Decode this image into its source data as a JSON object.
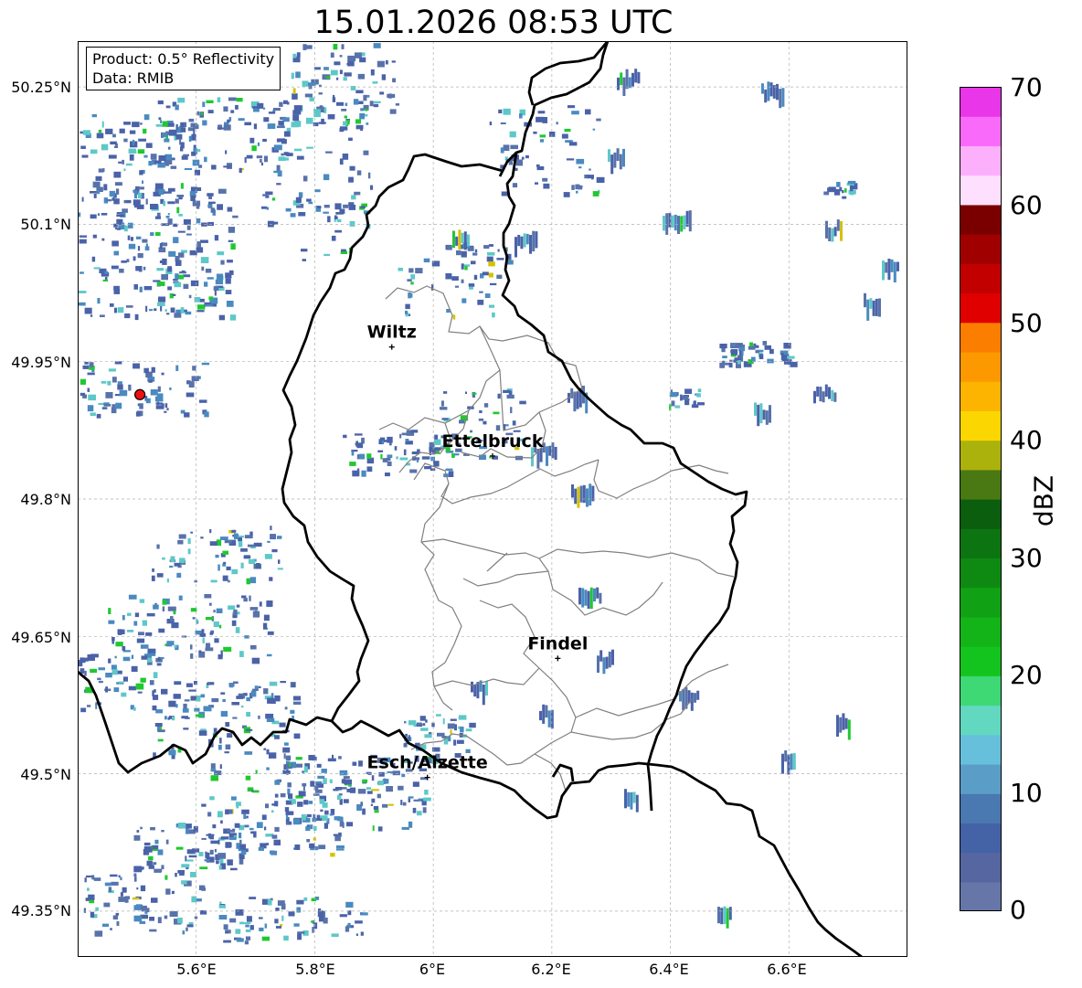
{
  "title": "15.01.2026 08:53 UTC",
  "info": {
    "product": "Product: 0.5° Reflectivity",
    "data": "Data: RMIB"
  },
  "y_ticks": [
    "50.25°N",
    "50.1°N",
    "49.95°N",
    "49.8°N",
    "49.65°N",
    "49.5°N",
    "49.35°N"
  ],
  "x_ticks": [
    "5.6°E",
    "5.8°E",
    "6°E",
    "6.2°E",
    "6.4°E",
    "6.6°E"
  ],
  "cities": [
    {
      "name": "Wiltz",
      "lon": 5.93,
      "lat": 49.966
    },
    {
      "name": "Ettelbruck",
      "lon": 6.1,
      "lat": 49.847
    },
    {
      "name": "Findel",
      "lon": 6.21,
      "lat": 49.626
    },
    {
      "name": "Esch/Alzette",
      "lon": 5.99,
      "lat": 49.496
    }
  ],
  "radar_site": {
    "lon": 5.505,
    "lat": 49.914
  },
  "map_extent": {
    "lon": [
      5.4,
      6.8
    ],
    "lat": [
      49.3,
      50.3
    ]
  },
  "colorbar": {
    "label": "dBZ",
    "ticks": [
      "0",
      "10",
      "20",
      "30",
      "40",
      "50",
      "60",
      "70"
    ],
    "min": 0,
    "max": 70,
    "step": 2.5,
    "colors": [
      "#6676a8",
      "#5566a0",
      "#4462a6",
      "#4a78b0",
      "#5a9ec8",
      "#66c0dc",
      "#62d8c0",
      "#3ed874",
      "#14c41e",
      "#12b418",
      "#10a214",
      "#0e8a12",
      "#0c7410",
      "#0a5e0e",
      "#4a7812",
      "#acb20c",
      "#fcd600",
      "#fcb400",
      "#fc9800",
      "#fc7e00",
      "#e00000",
      "#c20000",
      "#a00000",
      "#7a0000",
      "#fee0fe",
      "#fcb0fc",
      "#fa6afa",
      "#e836e8"
    ]
  },
  "colors": {
    "border": "#000000",
    "canton_border": "#808080",
    "radar_site": "#ee1111",
    "echo_palette": [
      "#4a62a8",
      "#5872aa",
      "#4a8ac0",
      "#5ec8c8",
      "#20c830",
      "#d4c200"
    ]
  }
}
